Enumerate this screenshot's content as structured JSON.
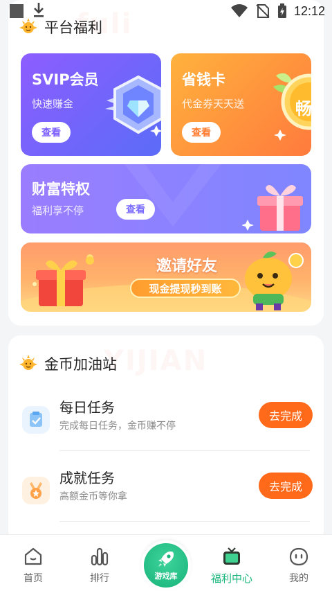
{
  "status_bar": {
    "time": "12:12"
  },
  "platform_section": {
    "title": "平台福利",
    "watermark": "fuli",
    "svip": {
      "title": "SVIP会员",
      "subtitle": "快速赚金",
      "button": "查看"
    },
    "saving_card": {
      "title": "省钱卡",
      "subtitle": "代金券天天送",
      "button": "查看",
      "badge": "畅"
    },
    "wealth": {
      "title": "财富特权",
      "subtitle": "福利享不停",
      "button": "查看"
    },
    "invite": {
      "title": "邀请好友",
      "button": "现金提现秒到账"
    }
  },
  "coin_section": {
    "title": "金币加油站",
    "watermark": "YIJIAN",
    "tasks": [
      {
        "title": "每日任务",
        "subtitle": "完成每日任务，金币赚不停",
        "button": "去完成",
        "icon": "checklist-icon"
      },
      {
        "title": "成就任务",
        "subtitle": "高额金币等你拿",
        "button": "去完成",
        "icon": "medal-icon"
      }
    ]
  },
  "bottom_nav": {
    "items": [
      {
        "label": "首页",
        "icon": "home-icon"
      },
      {
        "label": "排行",
        "icon": "ranking-icon"
      },
      {
        "label": "游戏库",
        "icon": "rocket-icon"
      },
      {
        "label": "福利中心",
        "icon": "gift-tv-icon",
        "active": true
      },
      {
        "label": "我的",
        "icon": "profile-face-icon"
      }
    ]
  },
  "colors": {
    "accent_green": "#17b57a",
    "task_button": "#ff6a1a",
    "svip_gradient": "#8d5dff",
    "saving_gradient": "#ff8a3d"
  }
}
